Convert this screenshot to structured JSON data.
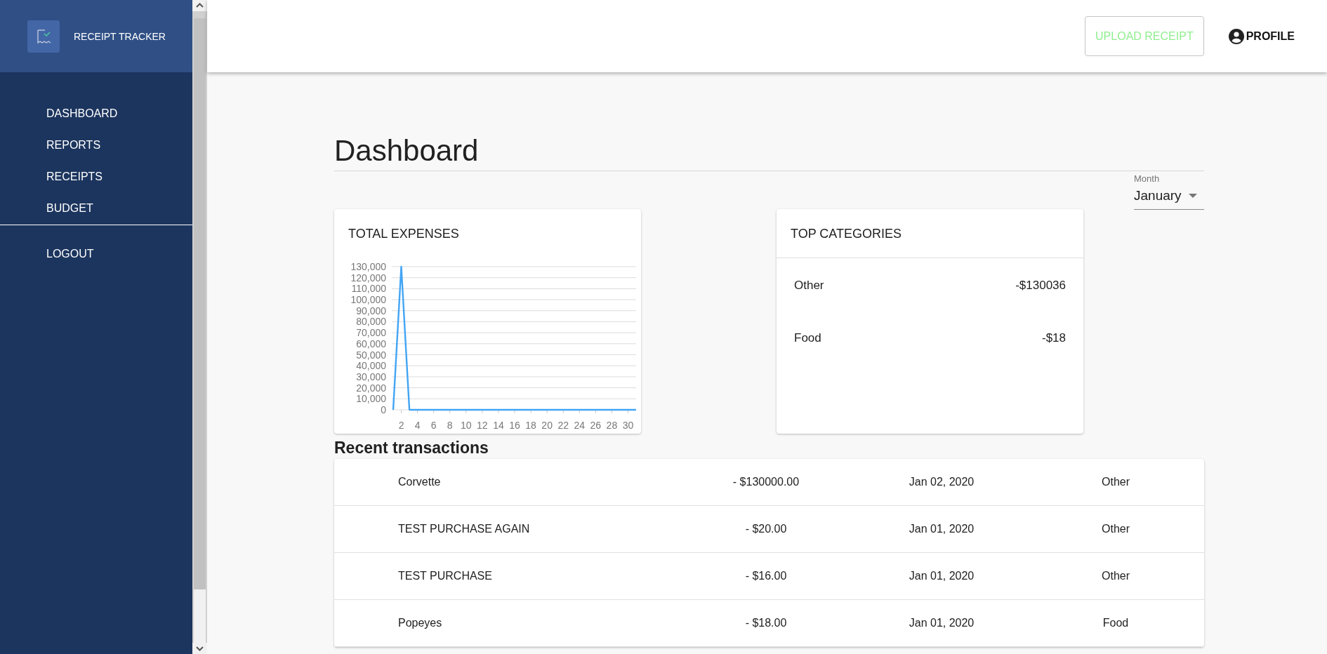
{
  "sidebar": {
    "brand": "RECEIPT TRACKER",
    "items": [
      {
        "label": "DASHBOARD"
      },
      {
        "label": "REPORTS"
      },
      {
        "label": "RECEIPTS"
      },
      {
        "label": "BUDGET"
      }
    ],
    "footer_items": [
      {
        "label": "LOGOUT"
      }
    ]
  },
  "header": {
    "upload_button": "UPLOAD RECEIPT",
    "profile": "PROFILE"
  },
  "page": {
    "title": "Dashboard",
    "month_field": {
      "label": "Month",
      "value": "January"
    }
  },
  "total_expenses": {
    "title": "TOTAL EXPENSES",
    "chart_data": {
      "type": "line",
      "x": [
        1,
        2,
        3,
        4,
        5,
        6,
        7,
        8,
        9,
        10,
        11,
        12,
        13,
        14,
        15,
        16,
        17,
        18,
        19,
        20,
        21,
        22,
        23,
        24,
        25,
        26,
        27,
        28,
        29,
        30,
        31
      ],
      "grid": true,
      "series": [
        {
          "color": "#42a5f5",
          "values": [
            0,
            130000,
            0,
            0,
            0,
            0,
            0,
            0,
            0,
            0,
            0,
            0,
            0,
            0,
            0,
            0,
            0,
            0,
            0,
            0,
            0,
            0,
            0,
            0,
            0,
            0,
            0,
            0,
            0,
            0,
            0
          ]
        }
      ],
      "xticks": [
        2,
        4,
        6,
        8,
        10,
        12,
        14,
        16,
        18,
        20,
        22,
        24,
        26,
        28,
        30
      ],
      "yticks": [
        {
          "value": 0,
          "label": "0"
        },
        {
          "value": 10000,
          "label": "10,000"
        },
        {
          "value": 20000,
          "label": "20,000"
        },
        {
          "value": 30000,
          "label": "30,000"
        },
        {
          "value": 40000,
          "label": "40,000"
        },
        {
          "value": 50000,
          "label": "50,000"
        },
        {
          "value": 60000,
          "label": "60,000"
        },
        {
          "value": 70000,
          "label": "70,000"
        },
        {
          "value": 80000,
          "label": "80,000"
        },
        {
          "value": 90000,
          "label": "90,000"
        },
        {
          "value": 100000,
          "label": "100,000"
        },
        {
          "value": 110000,
          "label": "110,000"
        },
        {
          "value": 120000,
          "label": "120,000"
        },
        {
          "value": 130000,
          "label": "130,000"
        }
      ],
      "ylim": [
        0,
        130000
      ],
      "xlim": [
        1,
        31
      ]
    }
  },
  "top_categories": {
    "title": "TOP CATEGORIES",
    "items": [
      {
        "name": "Other",
        "amount": "-$130036"
      },
      {
        "name": "Food",
        "amount": "-$18"
      }
    ]
  },
  "recent_transactions": {
    "title": "Recent transactions",
    "rows": [
      {
        "name": "Corvette",
        "amount": "- $130000.00",
        "date": "Jan 02, 2020",
        "category": "Other"
      },
      {
        "name": "TEST PURCHASE AGAIN",
        "amount": "- $20.00",
        "date": "Jan 01, 2020",
        "category": "Other"
      },
      {
        "name": "TEST PURCHASE",
        "amount": "- $16.00",
        "date": "Jan 01, 2020",
        "category": "Other"
      },
      {
        "name": "Popeyes",
        "amount": "- $18.00",
        "date": "Jan 01, 2020",
        "category": "Food"
      }
    ]
  }
}
